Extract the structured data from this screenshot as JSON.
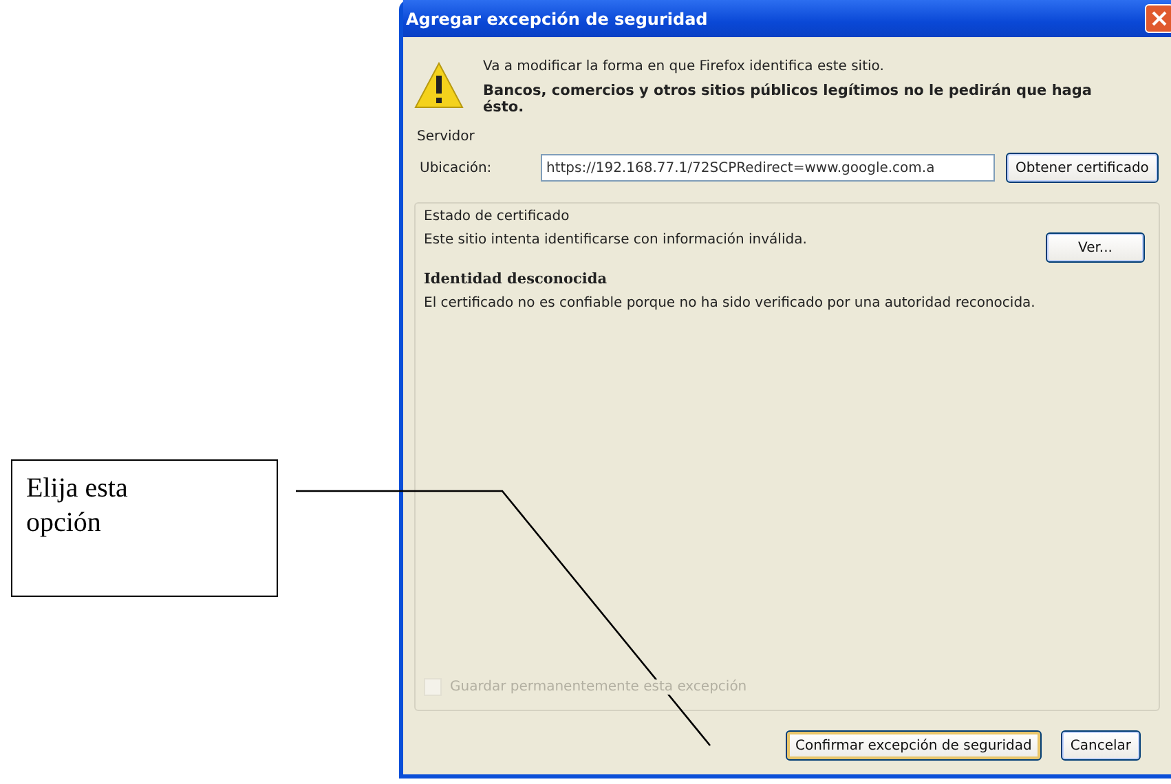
{
  "callout": {
    "text": "Elija esta opción"
  },
  "dialog": {
    "title": "Agregar excepción de seguridad",
    "intro": "Va a modificar la forma en que Firefox identifica este sitio.",
    "warning": "Bancos, comercios y otros sitios públicos legítimos no le pedirán que haga ésto.",
    "server": {
      "legend": "Servidor",
      "location_label": "Ubicación:",
      "location_value": "https://192.168.77.1/72SCPRedirect=www.google.com.a",
      "get_button": "Obtener certificado"
    },
    "status": {
      "legend": "Estado de certificado",
      "text": "Este sitio intenta identificarse con información inválida.",
      "view_button": "Ver...",
      "heading": "Identidad desconocida",
      "description": "El certificado no es confiable porque no ha sido verificado por una autoridad reconocida."
    },
    "permanent": {
      "label": "Guardar permanentemente esta excepción",
      "checked": false,
      "disabled": true
    },
    "buttons": [
      {
        "label": "Confirmar excepción de seguridad",
        "default": true
      },
      {
        "label": "Cancelar",
        "default": false
      }
    ]
  }
}
